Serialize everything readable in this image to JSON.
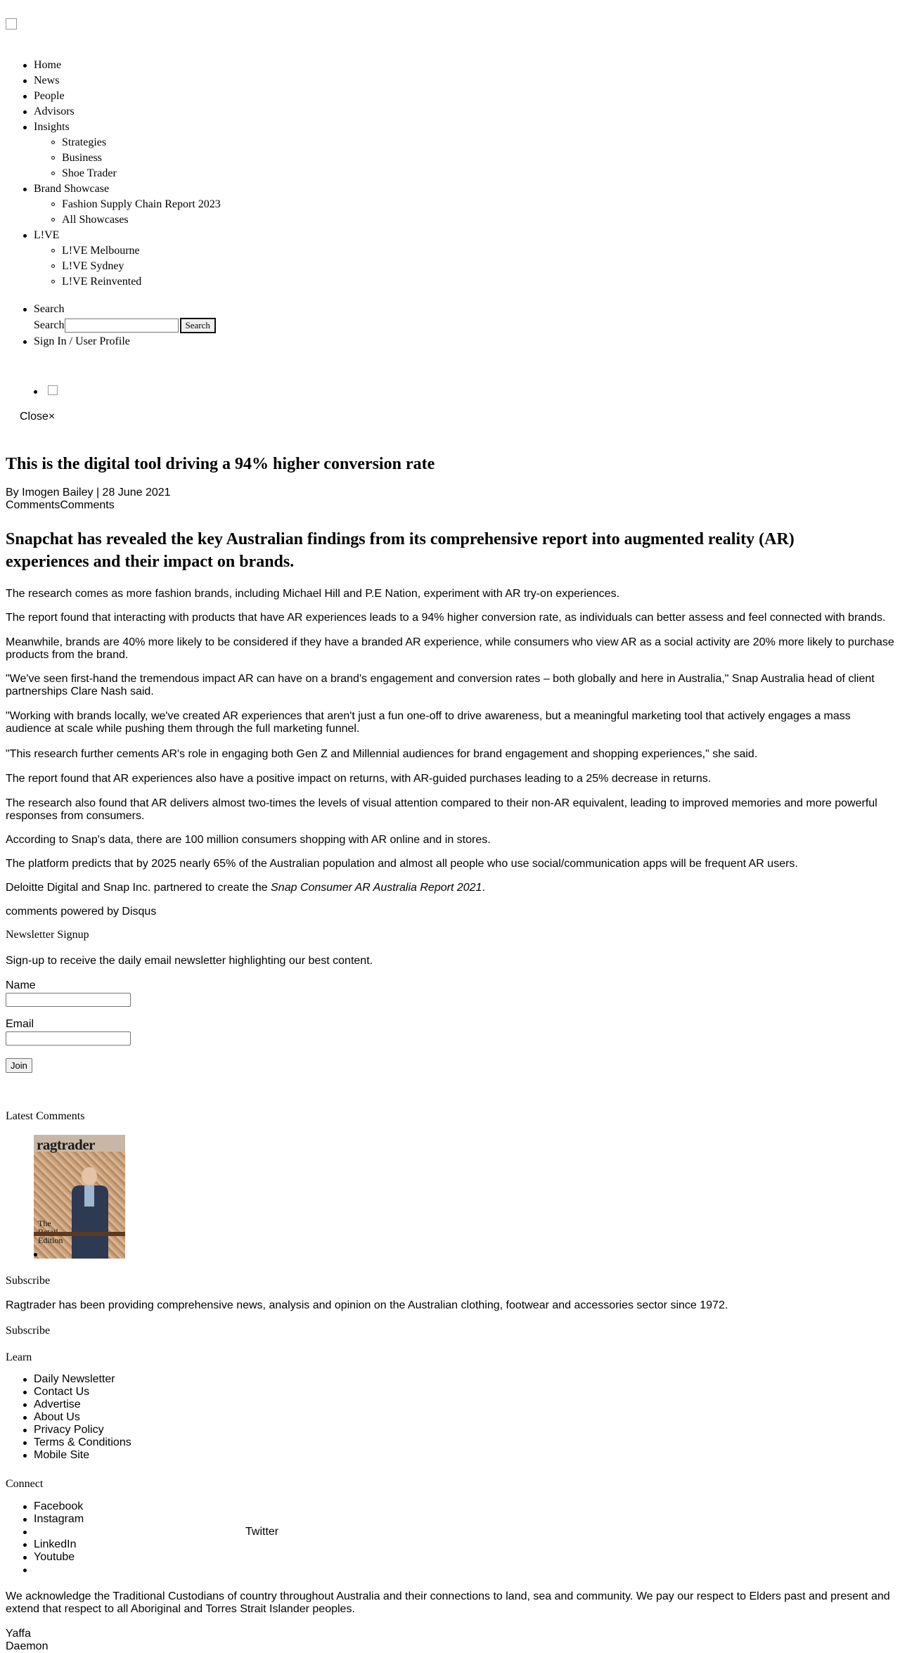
{
  "nav": {
    "items": [
      {
        "label": "Home"
      },
      {
        "label": "News"
      },
      {
        "label": "People"
      },
      {
        "label": "Advisors"
      },
      {
        "label": "Insights",
        "children": [
          "Strategies",
          "Business",
          "Shoe Trader"
        ]
      },
      {
        "label": "Brand Showcase",
        "children": [
          "Fashion Supply Chain Report 2023",
          "All Showcases"
        ]
      },
      {
        "label": "L!VE",
        "children": [
          "L!VE Melbourne",
          "L!VE Sydney",
          "L!VE Reinvented"
        ]
      }
    ]
  },
  "search": {
    "item_label": "Search",
    "field_label": "Search",
    "placeholder": "",
    "button_label": "Search"
  },
  "user": {
    "sign_in_label": "Sign In / User Profile"
  },
  "modal": {
    "close_label": "Close×"
  },
  "article": {
    "title": "This is the digital tool driving a 94% higher conversion rate",
    "byline": "By Imogen Bailey | 28 June 2021",
    "comments_label": "CommentsComments",
    "lede": "Snapchat has revealed the key Australian findings from its comprehensive report into augmented reality (AR) experiences and their impact on brands.",
    "paragraphs": [
      "The research comes as more fashion brands, including Michael Hill and P.E Nation, experiment with AR try-on experiences.",
      "The report found that interacting with products that have AR experiences leads to a 94% higher conversion rate, as individuals can better assess and feel connected with brands.",
      "Meanwhile, brands are 40% more likely to be considered if they have a branded AR experience, while consumers who view AR as a social activity are 20% more likely to purchase products from the brand.",
      "\"We've seen first-hand the tremendous impact AR can have on a brand's engagement and conversion rates – both globally and here in Australia,\" Snap Australia head of client partnerships Clare Nash said.",
      "\"Working with brands locally, we've created AR experiences that aren't just a fun one-off to drive awareness, but a meaningful marketing tool that actively engages a mass audience at scale while pushing them through the full marketing funnel.",
      "\"This research further cements AR's role in engaging both Gen Z and Millennial audiences for brand engagement and shopping experiences,\" she said.",
      "The report found that AR experiences also have a positive impact on returns, with AR-guided purchases leading to a 25% decrease in returns.",
      "The research also found that AR delivers almost two-times the levels of visual attention compared to their non-AR equivalent, leading to improved memories and more powerful responses from consumers.",
      "According to Snap's data, there are 100 million consumers shopping with AR online and in stores.",
      "The platform predicts that by 2025 nearly 65% of the Australian population and almost all people who use social/communication apps will be frequent AR users."
    ],
    "closing_prefix": "Deloitte Digital and Snap Inc. partnered to create the ",
    "closing_italic": "Snap Consumer AR Australia Report 2021",
    "closing_suffix": ".",
    "disqus": "comments powered by Disqus"
  },
  "newsletter": {
    "heading": "Newsletter Signup",
    "description": "Sign-up to receive the daily email newsletter highlighting our best content.",
    "name_label": "Name",
    "email_label": "Email",
    "join_label": "Join"
  },
  "latest_comments": {
    "heading": "Latest Comments"
  },
  "cover": {
    "masthead": "ragtrader",
    "edition_line1": "The",
    "edition_line2": "Retail",
    "edition_line3": "Edition"
  },
  "subscribe": {
    "heading": "Subscribe",
    "text": "Ragtrader has been providing comprehensive news, analysis and opinion on the Australian clothing, footwear and accessories sector since 1972.",
    "link": "Subscribe"
  },
  "learn": {
    "heading": "Learn",
    "items": [
      "Daily Newsletter",
      "Contact Us",
      "Advertise",
      "About Us",
      "Privacy Policy",
      "Terms & Conditions",
      "Mobile Site"
    ]
  },
  "connect": {
    "heading": "Connect",
    "items": [
      "Facebook",
      "Instagram",
      "",
      "LinkedIn",
      "Youtube",
      ""
    ],
    "twitter": "Twitter"
  },
  "acknowledgement": "We acknowledge the Traditional Custodians of country throughout Australia and their connections to land, sea and community. We pay our respect to Elders past and present and extend that respect to all Aboriginal and Torres Strait Islander peoples.",
  "footer_brands": [
    "Yaffa",
    "Daemon"
  ]
}
